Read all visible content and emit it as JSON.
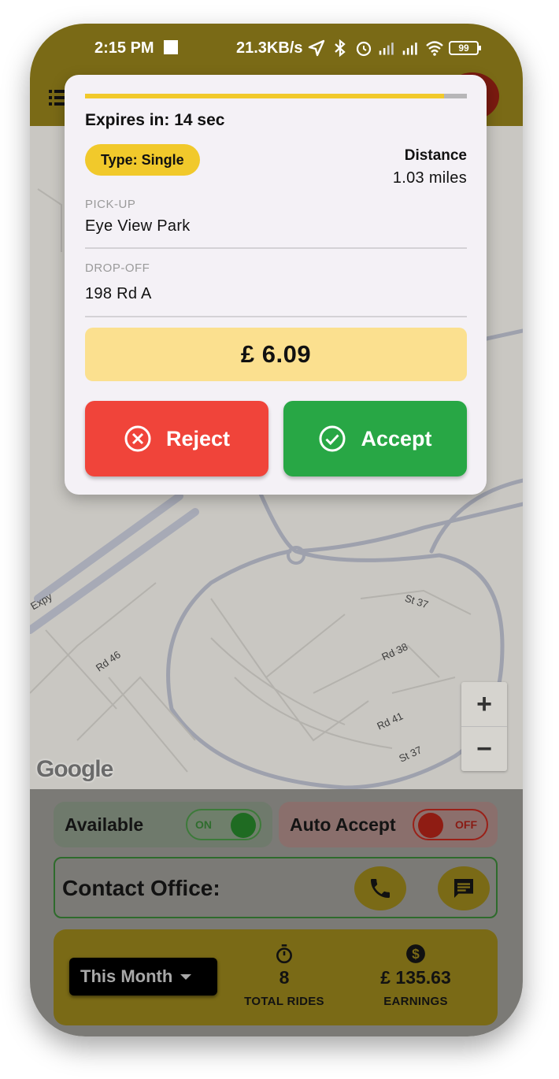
{
  "status_bar": {
    "time": "2:15 PM",
    "net_speed": "21.3KB/s",
    "battery": "99"
  },
  "offer": {
    "expires_label": "Expires in: 14 sec",
    "time_remaining_fraction": 0.94,
    "type_label": "Type:  Single",
    "distance_label": "Distance",
    "distance_value": "1.03 miles",
    "pickup_label": "PICK-UP",
    "pickup_value": "Eye View Park",
    "dropoff_label": "DROP-OFF",
    "dropoff_value": "198 Rd A",
    "fare": "£ 6.09",
    "reject_label": "Reject",
    "accept_label": "Accept"
  },
  "map": {
    "road_labels": [
      "St 37",
      "Rd 38",
      "Rd 46",
      "Rd 41",
      "St 37",
      "Expy"
    ],
    "attribution": "Google",
    "zoom_in": "+",
    "zoom_out": "−"
  },
  "controls": {
    "available_label": "Available",
    "available_state": "ON",
    "auto_accept_label": "Auto Accept",
    "auto_accept_state": "OFF",
    "contact_label": "Contact Office:"
  },
  "stats": {
    "period": "This Month",
    "total_rides_value": "8",
    "total_rides_label": "TOTAL RIDES",
    "earnings_value": "£ 135.63",
    "earnings_label": "EARNINGS"
  },
  "colors": {
    "accent_yellow": "#f1c92b",
    "reject_red": "#f0443a",
    "accept_green": "#28a745",
    "fare_bg": "#fbe08f"
  }
}
